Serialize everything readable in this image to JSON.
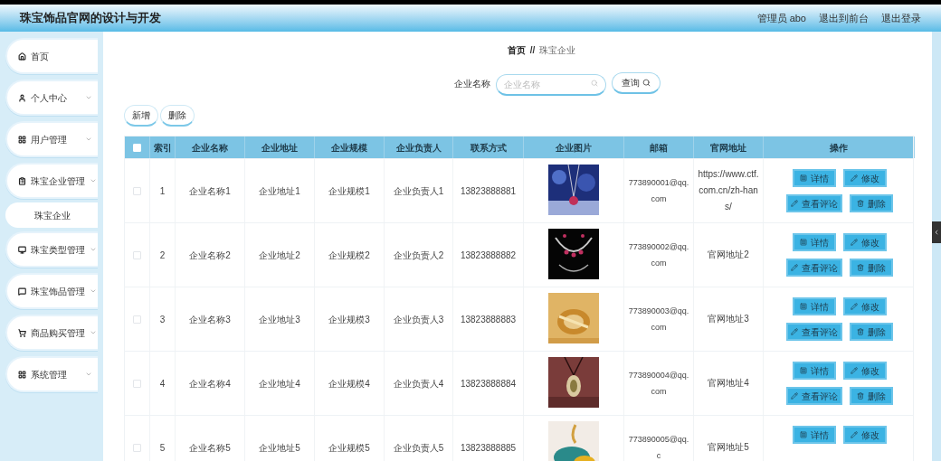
{
  "header": {
    "title": "珠宝饰品官网的设计与开发",
    "user": "管理员 abo",
    "links": [
      "退出到前台",
      "退出登录"
    ]
  },
  "sidebar": {
    "items": [
      {
        "label": "首页",
        "expandable": false
      },
      {
        "label": "个人中心",
        "expandable": true
      },
      {
        "label": "用户管理",
        "expandable": true
      },
      {
        "label": "珠宝企业管理",
        "expandable": true,
        "children": [
          {
            "label": "珠宝企业"
          }
        ]
      },
      {
        "label": "珠宝类型管理",
        "expandable": true
      },
      {
        "label": "珠宝饰品管理",
        "expandable": true
      },
      {
        "label": "商品购买管理",
        "expandable": true
      },
      {
        "label": "系统管理",
        "expandable": true
      }
    ]
  },
  "breadcrumb": {
    "items": [
      "首页",
      "珠宝企业"
    ],
    "separator": "//"
  },
  "search": {
    "label": "企业名称",
    "placeholder": "企业名称",
    "button": "查询"
  },
  "toolbar": [
    "新增",
    "删除"
  ],
  "table": {
    "select_all": {
      "checked": false
    },
    "columns": [
      "索引",
      "企业名称",
      "企业地址",
      "企业规模",
      "企业负责人",
      "联系方式",
      "企业图片",
      "邮箱",
      "官网地址",
      "操作"
    ],
    "rows": [
      {
        "checked": false,
        "cells": [
          "1",
          "企业名称1",
          "企业地址1",
          "企业规模1",
          "企业负责人1",
          "13823888881"
        ],
        "image": {
          "kind": "picture"
        },
        "email": "773890001@qq.com",
        "website": "https://www.ctf.com.cn/zh-hans/",
        "actions": [
          "详情",
          "修改",
          "查看评论",
          "删除"
        ]
      },
      {
        "checked": false,
        "cells": [
          "2",
          "企业名称2",
          "企业地址2",
          "企业规模2",
          "企业负责人2",
          "13823888882"
        ],
        "image": {
          "kind": "picture"
        },
        "email": "773890002@qq.com",
        "website": "官网地址2",
        "actions": [
          "详情",
          "修改",
          "查看评论",
          "删除"
        ]
      },
      {
        "checked": false,
        "cells": [
          "3",
          "企业名称3",
          "企业地址3",
          "企业规模3",
          "企业负责人3",
          "13823888883"
        ],
        "image": {
          "kind": "picture"
        },
        "email": "773890003@qq.com",
        "website": "官网地址3",
        "actions": [
          "详情",
          "修改",
          "查看评论",
          "删除"
        ]
      },
      {
        "checked": false,
        "cells": [
          "4",
          "企业名称4",
          "企业地址4",
          "企业规模4",
          "企业负责人4",
          "13823888884"
        ],
        "image": {
          "kind": "picture"
        },
        "email": "773890004@qq.com",
        "website": "官网地址4",
        "actions": [
          "详情",
          "修改",
          "查看评论",
          "删除"
        ]
      },
      {
        "checked": false,
        "cells": [
          "5",
          "企业名称5",
          "企业地址5",
          "企业规模5",
          "企业负责人5",
          "13823888885"
        ],
        "image": {
          "kind": "picture"
        },
        "email": "773890005@qq.c",
        "website": "官网地址5",
        "actions": [
          "详情",
          "修改"
        ]
      }
    ]
  }
}
